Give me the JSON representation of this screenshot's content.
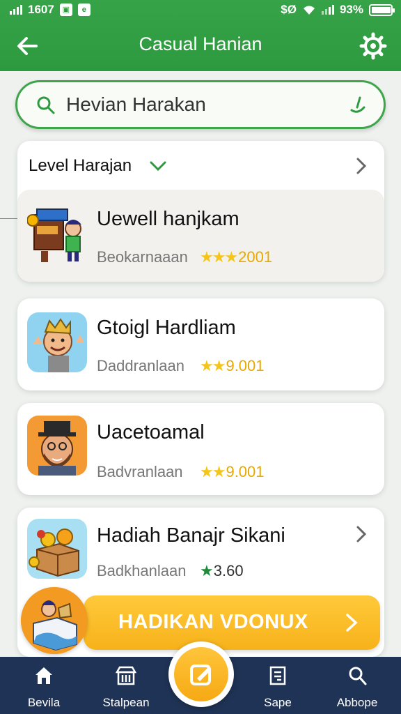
{
  "status_bar": {
    "time": "1607",
    "right_text": "$Ø",
    "battery": "93%"
  },
  "header": {
    "title": "Casual Hanian"
  },
  "search": {
    "value": "Hevian Harakan"
  },
  "level_row": {
    "label": "Level Harajan"
  },
  "games": [
    {
      "title": "Uewell hanjkam",
      "category": "Beokarnaaan",
      "rating_stars": "★★★",
      "rating": "2001"
    },
    {
      "title": "Gtoigl Hardliam",
      "category": "Daddranlaan",
      "rating_stars": "★★",
      "rating": "9.001"
    },
    {
      "title": "Uacetoamal",
      "category": "Badvranlaan",
      "rating_stars": "★★",
      "rating": "9.001"
    },
    {
      "title": "Hadiah Banajr Sikani",
      "category": "Badkhanlaan",
      "rating_stars": "★",
      "rating": "3.60"
    }
  ],
  "bonus": {
    "label": "HADIKAN VDONUX"
  },
  "bottom_nav": [
    {
      "label": "Bevila",
      "icon": "home-icon"
    },
    {
      "label": "Stalpean",
      "icon": "store-icon"
    },
    {
      "label": "Sape",
      "icon": "document-icon"
    },
    {
      "label": "Abbope",
      "icon": "search-icon"
    }
  ],
  "colors": {
    "header_green": "#2e9a40",
    "accent_yellow": "#f7b21a",
    "nav_navy": "#1f3356"
  }
}
